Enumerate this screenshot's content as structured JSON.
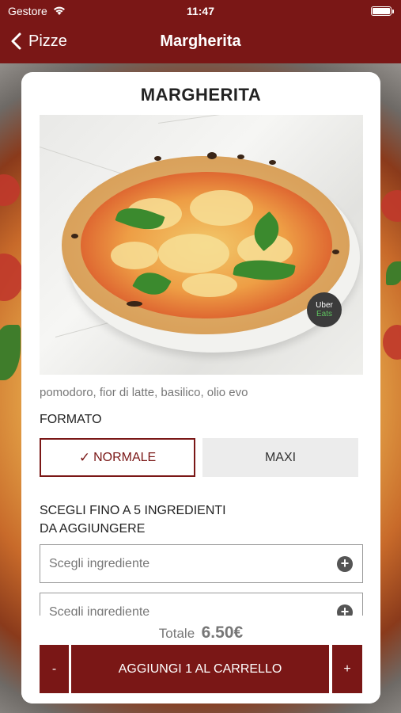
{
  "status_bar": {
    "carrier": "Gestore",
    "time": "11:47"
  },
  "nav": {
    "back_label": "Pizze",
    "title": "Margherita"
  },
  "product": {
    "name": "MARGHERITA",
    "badge": {
      "line1": "Uber",
      "line2": "Eats"
    },
    "description": "pomodoro, fior di latte, basilico, olio evo"
  },
  "format": {
    "label": "FORMATO",
    "options": [
      {
        "label": "NORMALE",
        "selected": true
      },
      {
        "label": "MAXI",
        "selected": false
      }
    ]
  },
  "ingredients": {
    "label_line1": "SCEGLI FINO A 5 INGREDIENTI",
    "label_line2": "DA AGGIUNGERE",
    "fields": [
      {
        "placeholder": "Scegli ingrediente"
      },
      {
        "placeholder": "Scegli ingrediente"
      }
    ]
  },
  "footer": {
    "total_label": "Totale",
    "total_value": "6.50€",
    "minus": "-",
    "add_to_cart": "AGGIUNGI 1 AL CARRELLO",
    "plus": "+"
  },
  "colors": {
    "brand": "#7a1716",
    "selected_border": "#7a1716",
    "unselected_bg": "#ececec"
  },
  "icons": [
    "wifi-icon",
    "battery-icon",
    "back-chevron-icon",
    "plus-circle-icon"
  ]
}
